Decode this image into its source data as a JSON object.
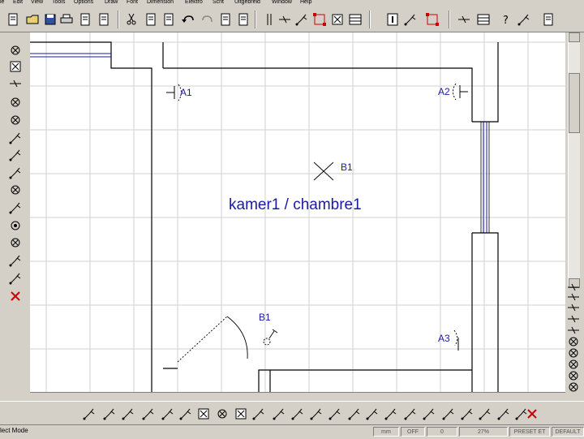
{
  "menu": [
    "le",
    "Edit",
    "View",
    "Tools",
    "Options",
    "Draw",
    "Font",
    "Dimension",
    "Elektro",
    "Scrit",
    "Uitgebreid",
    "Window",
    "Help"
  ],
  "drawing": {
    "room_label": "kamer1 / chambre1",
    "symbols": {
      "a1": "A1",
      "a2": "A2",
      "a3": "A3",
      "b1_top": "B1",
      "b1_bottom": "B1"
    }
  },
  "status": {
    "mode": "lect Mode",
    "unit": "mm",
    "snap": "OFF",
    "value": "0",
    "zoom": "27%",
    "preset": "PRESET ET",
    "layer": "DEFAULT"
  },
  "colors": {
    "drawing_text": "#1a1aa6",
    "wall_line": "#000000",
    "window_line": "#1a1aa6",
    "grid": "#d0d0d0",
    "chrome": "#d4d0c8",
    "delete_red": "#cc0000"
  },
  "icons": {
    "toolbar_top": [
      "new-icon",
      "open-icon",
      "save-icon",
      "print-icon",
      "print-preview-icon",
      "properties-icon",
      "cut-icon",
      "copy-icon",
      "paste-icon",
      "undo-icon",
      "redo-icon",
      "copy-r-icon",
      "paste-r-icon",
      "parallel-icon",
      "line-icon",
      "point-icon",
      "node-icon",
      "box-select-icon",
      "table-icon",
      "info-icon",
      "help-pointer-icon",
      "zoom-window-icon",
      "measure-icon",
      "grid-icon",
      "help-icon",
      "pen-icon",
      "fill-icon"
    ],
    "toolbar_left": [
      "close-icon",
      "cross-box-icon",
      "wall-icon",
      "circle-cross-icon",
      "double-circle-icon",
      "switch-icon",
      "switch-double-icon",
      "switch-triple-icon",
      "motor-icon",
      "socket-icon",
      "target-icon",
      "lamp-icon",
      "fan-icon",
      "meter-icon",
      "delete-icon"
    ],
    "toolbar_bottom": [
      "socket-double-icon",
      "socket-triple-icon",
      "switch-a-icon",
      "switch-b-icon",
      "switch-c-icon",
      "line-switch-icon",
      "box-icon",
      "timer-icon",
      "arrow-box-icon",
      "switch-d-icon",
      "switch-e-icon",
      "switch-f-icon",
      "switch-g-icon",
      "switch-h-icon",
      "switch-i-icon",
      "switch-j-icon",
      "switch-k-icon",
      "switch-l-icon",
      "switch-m-icon",
      "switch-n-icon",
      "switch-o-icon",
      "switch-p-icon",
      "switch-q-icon",
      "switch-r-icon",
      "delete-red-icon"
    ]
  }
}
